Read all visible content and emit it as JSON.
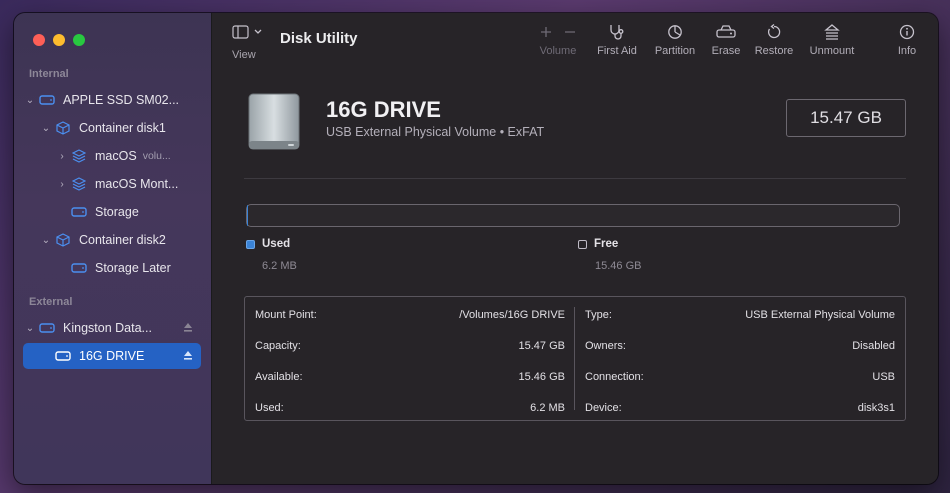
{
  "app": {
    "title": "Disk Utility"
  },
  "toolbar": {
    "view_label": "View",
    "volume_label": "Volume",
    "first_aid_label": "First Aid",
    "partition_label": "Partition",
    "erase_label": "Erase",
    "restore_label": "Restore",
    "unmount_label": "Unmount",
    "info_label": "Info"
  },
  "sidebar": {
    "internal_label": "Internal",
    "external_label": "External",
    "items": [
      {
        "label": "APPLE SSD SM02...",
        "icon": "hard-drive-icon"
      },
      {
        "label": "Container disk1",
        "icon": "container-icon"
      },
      {
        "label": "macOS",
        "sub": "volu...",
        "icon": "volume-stack-icon"
      },
      {
        "label": "macOS Mont...",
        "icon": "volume-stack-icon"
      },
      {
        "label": "Storage",
        "icon": "hard-drive-icon"
      },
      {
        "label": "Container disk2",
        "icon": "container-icon"
      },
      {
        "label": "Storage Later",
        "icon": "hard-drive-icon"
      },
      {
        "label": "Kingston Data...",
        "icon": "hard-drive-icon"
      },
      {
        "label": "16G DRIVE",
        "icon": "hard-drive-icon"
      }
    ]
  },
  "drive": {
    "name": "16G DRIVE",
    "description": "USB External Physical Volume • ExFAT",
    "size": "15.47 GB"
  },
  "usage": {
    "used_label": "Used",
    "used_value": "6.2 MB",
    "free_label": "Free",
    "free_value": "15.46 GB",
    "used_fraction": 0.0004,
    "used_color": "#3a83d6"
  },
  "info": {
    "left": [
      {
        "key": "Mount Point:",
        "value": "/Volumes/16G DRIVE"
      },
      {
        "key": "Capacity:",
        "value": "15.47 GB"
      },
      {
        "key": "Available:",
        "value": "15.46 GB"
      },
      {
        "key": "Used:",
        "value": "6.2 MB"
      }
    ],
    "right": [
      {
        "key": "Type:",
        "value": "USB External Physical Volume"
      },
      {
        "key": "Owners:",
        "value": "Disabled"
      },
      {
        "key": "Connection:",
        "value": "USB"
      },
      {
        "key": "Device:",
        "value": "disk3s1"
      }
    ]
  }
}
